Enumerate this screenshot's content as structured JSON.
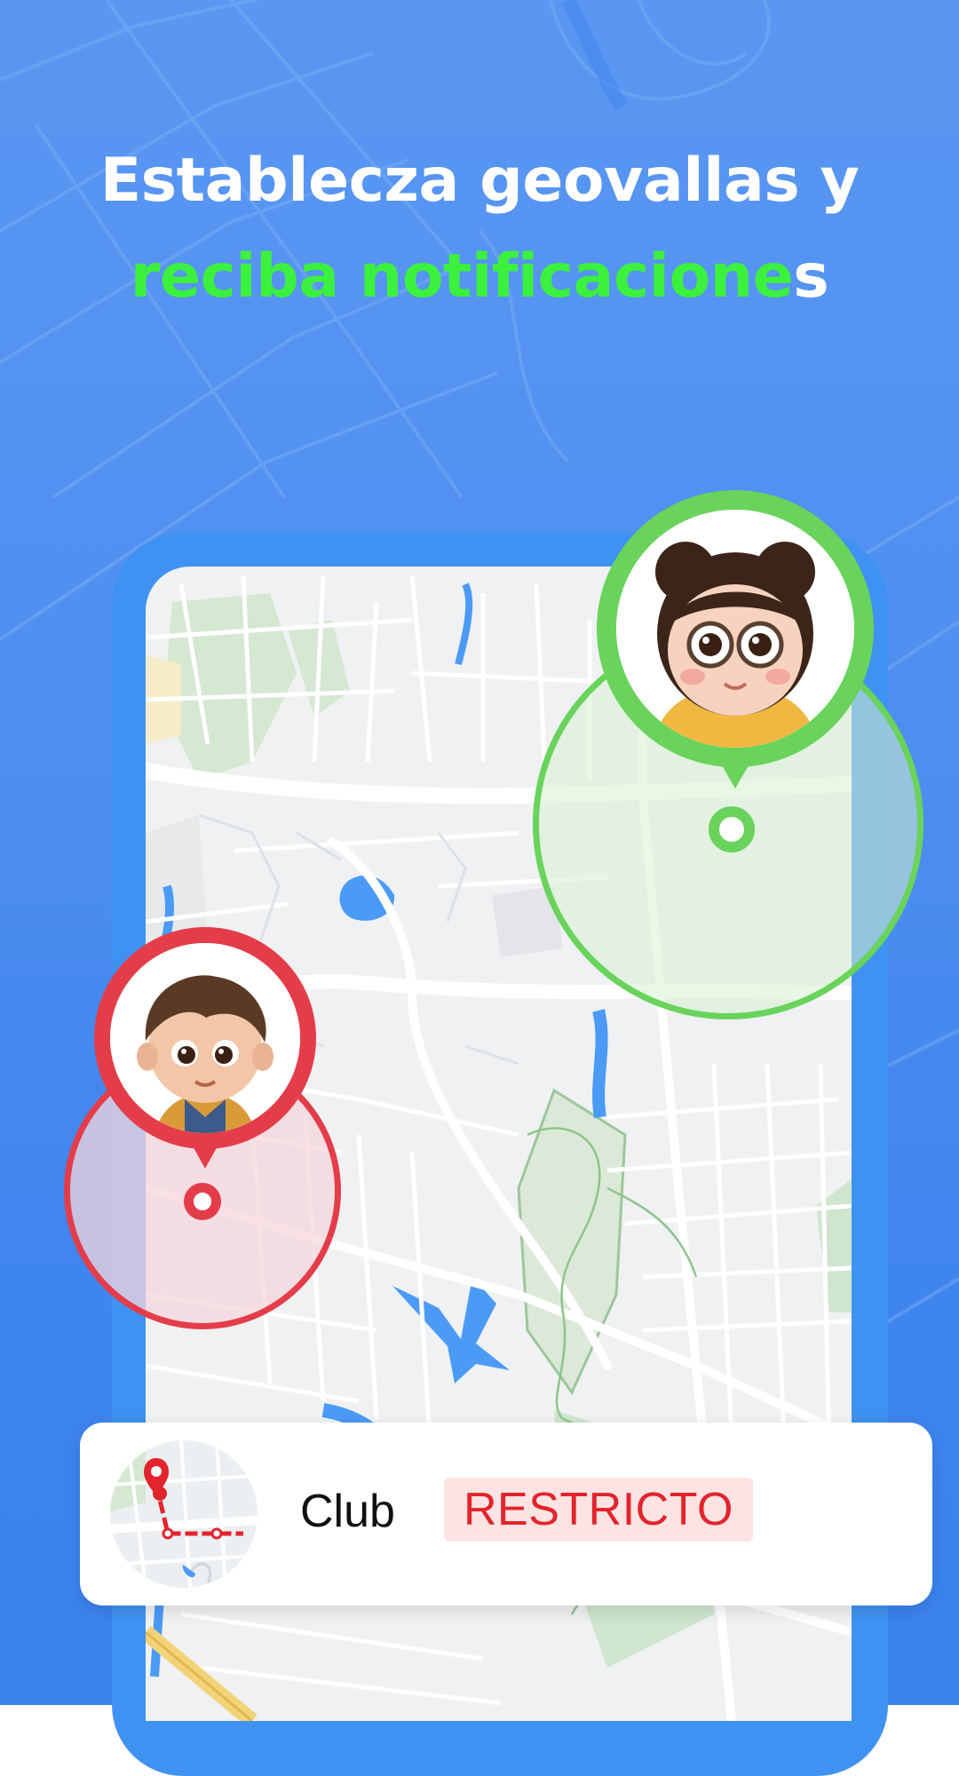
{
  "headline": {
    "line1": "Establecza geovallas y",
    "line2_green": "reciba notificacione",
    "line2_white": "s"
  },
  "geofences": [
    {
      "name": "girl-geofence",
      "status_color": "#69d35c"
    },
    {
      "name": "boy-geofence",
      "status_color": "#e43d4a"
    }
  ],
  "card": {
    "label": "Club",
    "badge": "RESTRICTO",
    "badge_color": "#e2242c",
    "thumb_icon": "route-map-pin-icon"
  },
  "colors": {
    "background": "#4d8ef0",
    "phone_frame": "#3f92f1",
    "accent_green": "#3bf13e"
  }
}
